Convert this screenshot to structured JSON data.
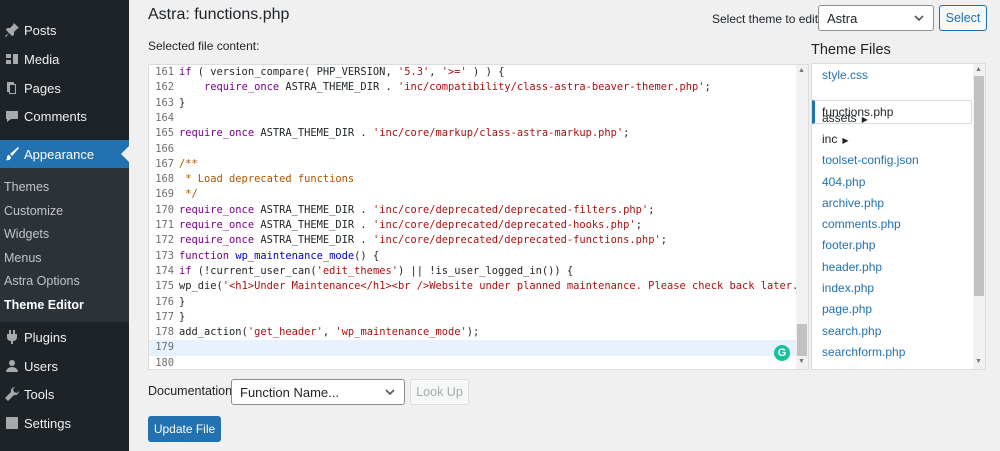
{
  "sidebar": {
    "menu": [
      {
        "label": "Posts",
        "icon": "pin-icon"
      },
      {
        "label": "Media",
        "icon": "media-icon"
      },
      {
        "label": "Pages",
        "icon": "pages-icon"
      },
      {
        "label": "Comments",
        "icon": "comments-icon"
      },
      {
        "label": "Appearance",
        "icon": "brush-icon"
      },
      {
        "label": "Plugins",
        "icon": "plugin-icon"
      },
      {
        "label": "Users",
        "icon": "users-icon"
      },
      {
        "label": "Tools",
        "icon": "wrench-icon"
      },
      {
        "label": "Settings",
        "icon": "settings-icon"
      }
    ],
    "submenu": [
      "Themes",
      "Customize",
      "Widgets",
      "Menus",
      "Astra Options",
      "Theme Editor"
    ]
  },
  "header": {
    "title": "Astra: functions.php",
    "file_label": "Selected file content:",
    "theme_select_label": "Select theme to edit:",
    "theme_selected": "Astra",
    "select_button": "Select"
  },
  "editor": {
    "lines": [
      {
        "n": "161",
        "text": "if ( version_compare( PHP_VERSION, '5.3', '>=' ) ) {"
      },
      {
        "n": "162",
        "text": "    require_once ASTRA_THEME_DIR . 'inc/compatibility/class-astra-beaver-themer.php';"
      },
      {
        "n": "163",
        "text": "}"
      },
      {
        "n": "164",
        "text": ""
      },
      {
        "n": "165",
        "text": "require_once ASTRA_THEME_DIR . 'inc/core/markup/class-astra-markup.php';"
      },
      {
        "n": "166",
        "text": ""
      },
      {
        "n": "167",
        "text": "/**"
      },
      {
        "n": "168",
        "text": " * Load deprecated functions"
      },
      {
        "n": "169",
        "text": " */"
      },
      {
        "n": "170",
        "text": "require_once ASTRA_THEME_DIR . 'inc/core/deprecated/deprecated-filters.php';"
      },
      {
        "n": "171",
        "text": "require_once ASTRA_THEME_DIR . 'inc/core/deprecated/deprecated-hooks.php';"
      },
      {
        "n": "172",
        "text": "require_once ASTRA_THEME_DIR . 'inc/core/deprecated/deprecated-functions.php';"
      },
      {
        "n": "173",
        "text": "function wp_maintenance_mode() {"
      },
      {
        "n": "174",
        "text": "if (!current_user_can('edit_themes') || !is_user_logged_in()) {"
      },
      {
        "n": "175",
        "text": "wp_die('<h1>Under Maintenance</h1><br />Website under planned maintenance. Please check back later."
      },
      {
        "n": "176",
        "text": "}"
      },
      {
        "n": "177",
        "text": "}"
      },
      {
        "n": "178",
        "text": "add_action('get_header', 'wp_maintenance_mode');"
      },
      {
        "n": "179",
        "text": ""
      },
      {
        "n": "180",
        "text": ""
      }
    ]
  },
  "files": {
    "heading": "Theme Files",
    "items": [
      "style.css",
      "functions.php",
      "assets",
      "inc",
      "toolset-config.json",
      "404.php",
      "archive.php",
      "comments.php",
      "footer.php",
      "header.php",
      "index.php",
      "page.php",
      "search.php",
      "searchform.php"
    ],
    "current": "functions.php",
    "dir_arrow": "▶"
  },
  "footer": {
    "doc_label": "Documentation:",
    "doc_selected": "Function Name...",
    "lookup_button": "Look Up",
    "update_button": "Update File"
  },
  "colors": {
    "sidebar_bg": "#1d2327",
    "accent": "#2271b1",
    "page_bg": "#f0f0f1"
  }
}
